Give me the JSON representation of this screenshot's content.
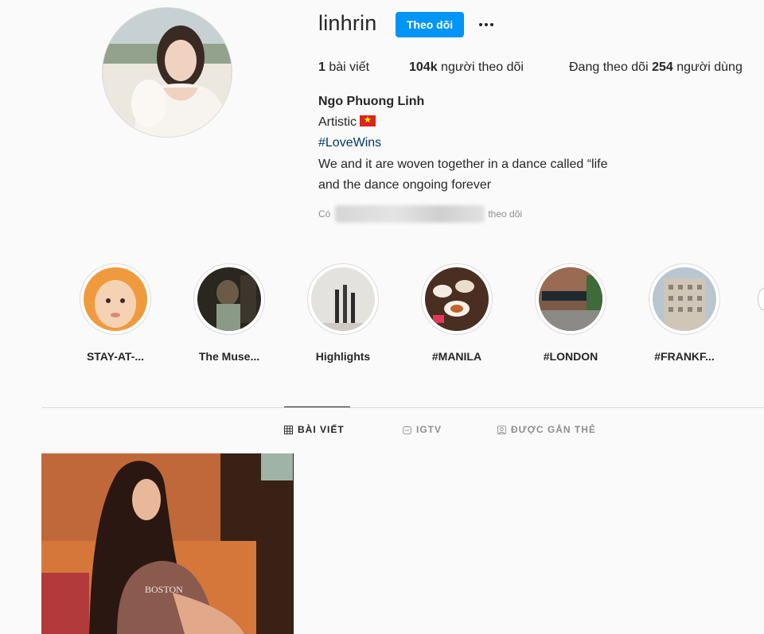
{
  "profile": {
    "username": "linhrin",
    "follow_label": "Theo dõi",
    "more_label": "•••",
    "posts_count": "1",
    "posts_label": "bài viết",
    "followers_count": "104k",
    "followers_label": "người theo dõi",
    "following_prefix": "Đang theo dõi",
    "following_count": "254",
    "following_suffix": "người dùng",
    "full_name": "Ngo Phuong Linh",
    "bio_line1": "Artistic",
    "hashtag": "#LoveWins",
    "bio_line3": "We and it are woven together in a dance called “life",
    "bio_line4": "and the dance ongoing forever",
    "followed_by_prefix": "Có",
    "followed_by_suffix": "theo dõi"
  },
  "highlights": [
    {
      "label": "STAY-AT-...",
      "icon": "baby-photo"
    },
    {
      "label": "The Muse...",
      "icon": "dark-photo"
    },
    {
      "label": "Highlights",
      "icon": "pens-photo"
    },
    {
      "label": "#MANILA",
      "icon": "food-photo"
    },
    {
      "label": "#LONDON",
      "icon": "street-photo"
    },
    {
      "label": "#FRANKF...",
      "icon": "building-photo"
    }
  ],
  "tabs": [
    {
      "label": "BÀI VIẾT",
      "icon": "grid-icon",
      "active": true
    },
    {
      "label": "IGTV",
      "icon": "igtv-icon",
      "active": false
    },
    {
      "label": "ĐƯỢC GẮN THẺ",
      "icon": "tagged-icon",
      "active": false
    }
  ],
  "colors": {
    "accent": "#0095f6",
    "hashtag": "#00376b",
    "background": "#fafafa",
    "muted": "#8e8e8e"
  }
}
